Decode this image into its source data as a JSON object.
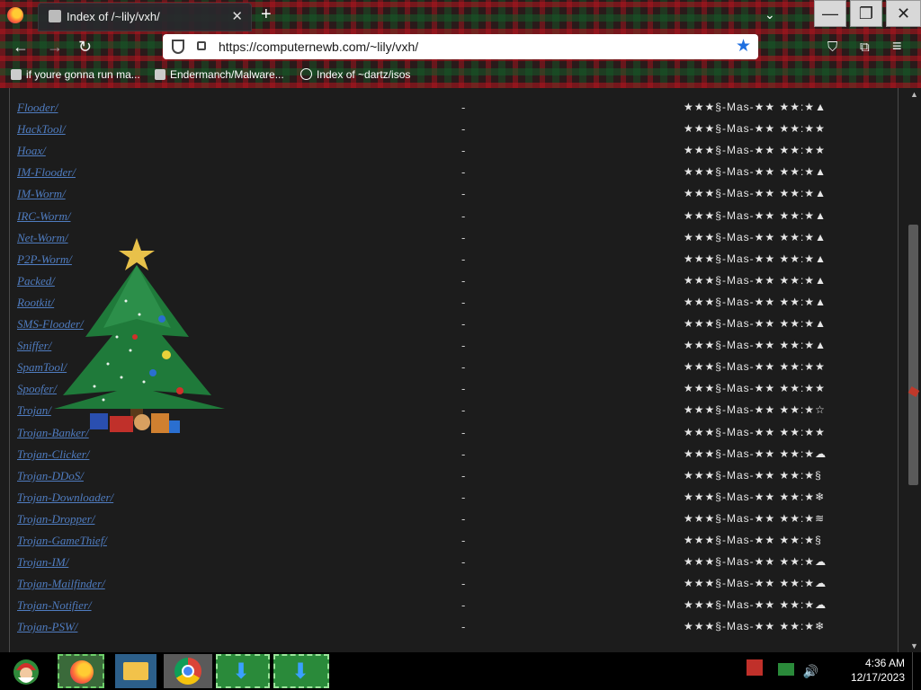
{
  "window": {
    "tab_title": "Index of /~lily/vxh/",
    "tab_close": "✕",
    "new_tab": "+",
    "tab_list": "⌄",
    "min": "—",
    "max": "❐",
    "close": "✕"
  },
  "toolbar": {
    "back": "←",
    "forward": "→",
    "reload": "↻",
    "url": "https://computernewb.com/~lily/vxh/",
    "star": "★",
    "pocket": "⛉",
    "extensions": "⧉",
    "menu": "≡"
  },
  "bookmarks": [
    {
      "label": "if youre gonna run ma..."
    },
    {
      "label": "Endermanch/Malware..."
    },
    {
      "label": "Index of ~dartz/isos"
    }
  ],
  "listing": {
    "rows": [
      {
        "name": "Flooder/",
        "size": "-",
        "date": "★★★§-Mas-★★ ★★:★▲"
      },
      {
        "name": "HackTool/",
        "size": "-",
        "date": "★★★§-Mas-★★ ★★:★★"
      },
      {
        "name": "Hoax/",
        "size": "-",
        "date": "★★★§-Mas-★★ ★★:★★"
      },
      {
        "name": "IM-Flooder/",
        "size": "-",
        "date": "★★★§-Mas-★★ ★★:★▲"
      },
      {
        "name": "IM-Worm/",
        "size": "-",
        "date": "★★★§-Mas-★★ ★★:★▲"
      },
      {
        "name": "IRC-Worm/",
        "size": "-",
        "date": "★★★§-Mas-★★ ★★:★▲"
      },
      {
        "name": "Net-Worm/",
        "size": "-",
        "date": "★★★§-Mas-★★ ★★:★▲"
      },
      {
        "name": "P2P-Worm/",
        "size": "-",
        "date": "★★★§-Mas-★★ ★★:★▲"
      },
      {
        "name": "Packed/",
        "size": "-",
        "date": "★★★§-Mas-★★ ★★:★▲"
      },
      {
        "name": "Rootkit/",
        "size": "-",
        "date": "★★★§-Mas-★★ ★★:★▲"
      },
      {
        "name": "SMS-Flooder/",
        "size": "-",
        "date": "★★★§-Mas-★★ ★★:★▲"
      },
      {
        "name": "Sniffer/",
        "size": "-",
        "date": "★★★§-Mas-★★ ★★:★▲"
      },
      {
        "name": "SpamTool/",
        "size": "-",
        "date": "★★★§-Mas-★★ ★★:★★"
      },
      {
        "name": "Spoofer/",
        "size": "-",
        "date": "★★★§-Mas-★★ ★★:★★"
      },
      {
        "name": "Trojan/",
        "size": "-",
        "date": "★★★§-Mas-★★ ★★:★☆"
      },
      {
        "name": "Trojan-Banker/",
        "size": "-",
        "date": "★★★§-Mas-★★ ★★:★★"
      },
      {
        "name": "Trojan-Clicker/",
        "size": "-",
        "date": "★★★§-Mas-★★ ★★:★☁"
      },
      {
        "name": "Trojan-DDoS/",
        "size": "-",
        "date": "★★★§-Mas-★★ ★★:★§"
      },
      {
        "name": "Trojan-Downloader/",
        "size": "-",
        "date": "★★★§-Mas-★★ ★★:★❄"
      },
      {
        "name": "Trojan-Dropper/",
        "size": "-",
        "date": "★★★§-Mas-★★ ★★:★≋"
      },
      {
        "name": "Trojan-GameThief/",
        "size": "-",
        "date": "★★★§-Mas-★★ ★★:★§"
      },
      {
        "name": "Trojan-IM/",
        "size": "-",
        "date": "★★★§-Mas-★★ ★★:★☁"
      },
      {
        "name": "Trojan-Mailfinder/",
        "size": "-",
        "date": "★★★§-Mas-★★ ★★:★☁"
      },
      {
        "name": "Trojan-Notifier/",
        "size": "-",
        "date": "★★★§-Mas-★★ ★★:★☁"
      },
      {
        "name": "Trojan-PSW/",
        "size": "-",
        "date": "★★★§-Mas-★★ ★★:★❄"
      }
    ]
  },
  "taskbar": {
    "time": "4:36 AM",
    "date": "12/17/2023"
  }
}
